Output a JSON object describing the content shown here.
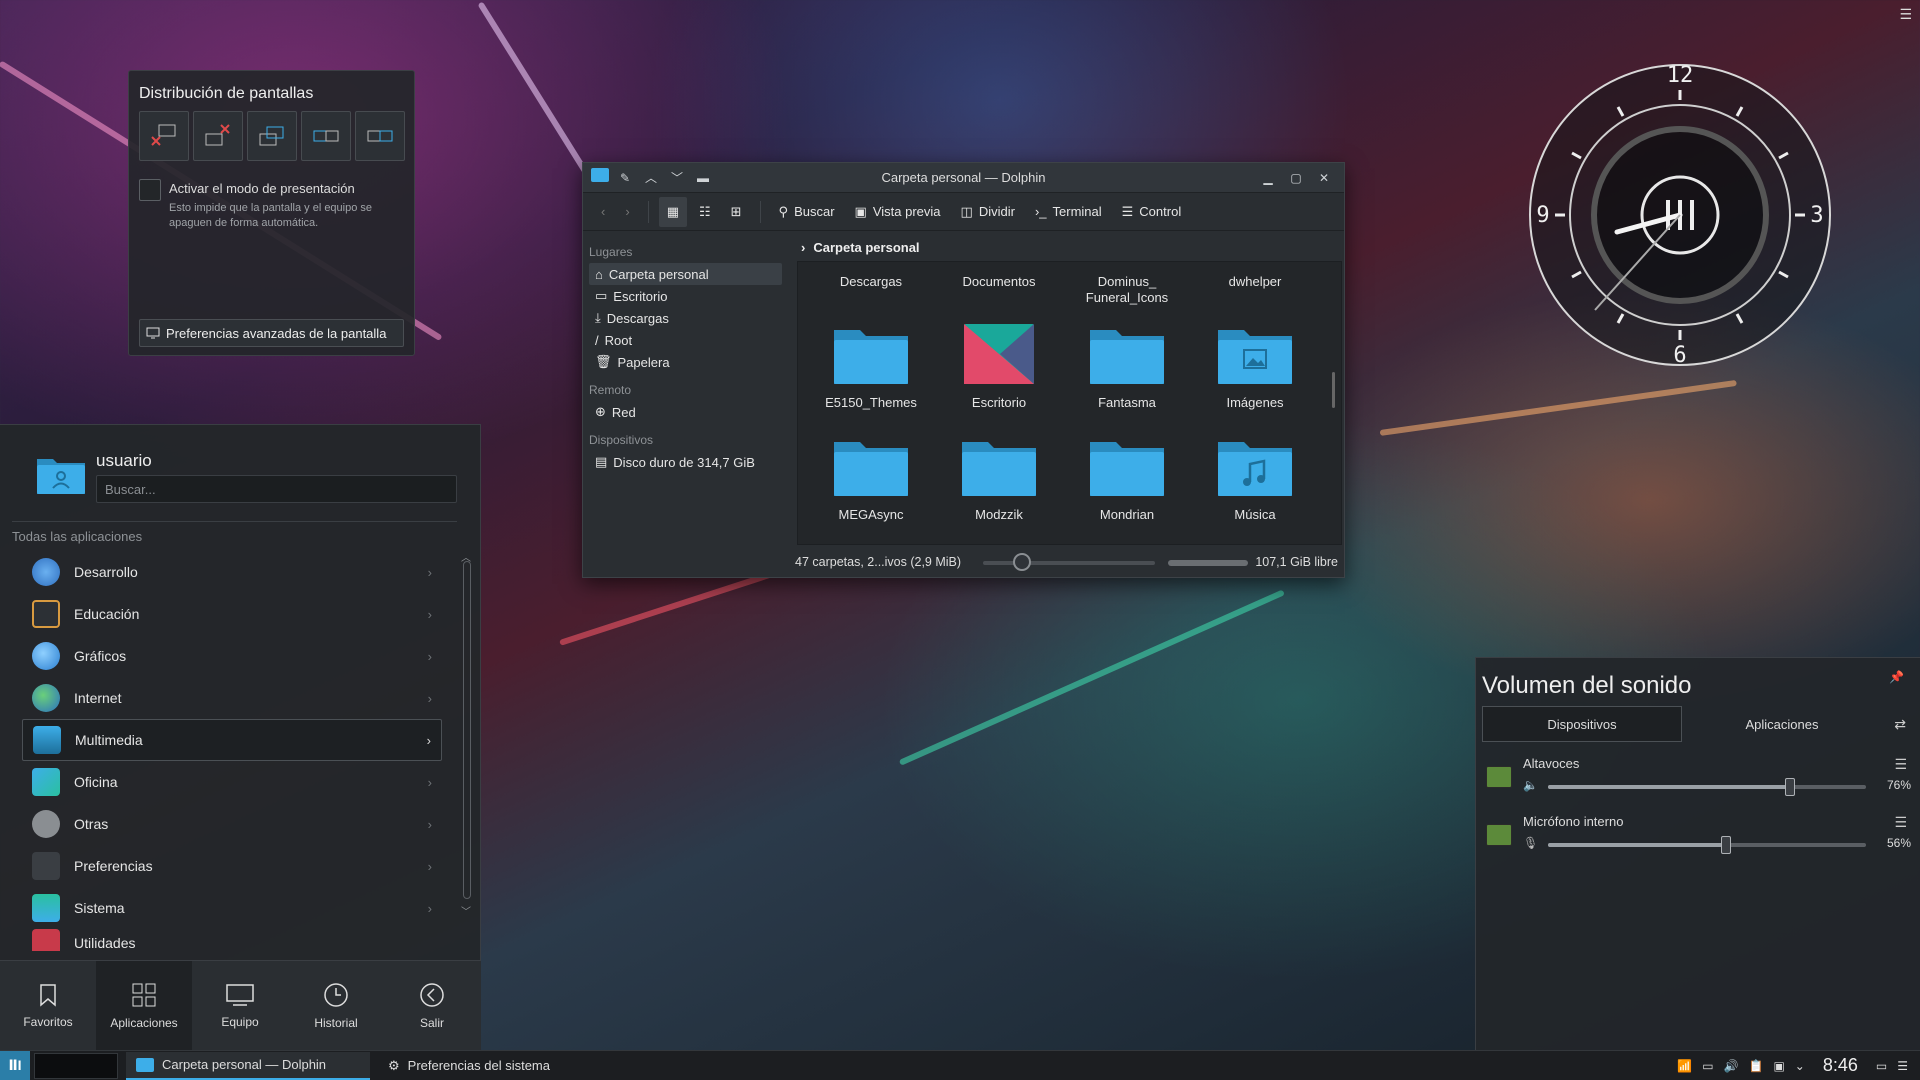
{
  "screen_layout": {
    "title": "Distribución de pantallas",
    "presentation_label": "Activar el modo de presentación",
    "presentation_desc": "Esto impide que la pantalla y el equipo se apaguen de forma automática.",
    "advanced_label": "Preferencias avanzadas de la pantalla"
  },
  "clock": {
    "n12": "12",
    "n3": "3",
    "n6": "6",
    "n9": "9"
  },
  "dolphin": {
    "title": "Carpeta personal — Dolphin",
    "toolbar": {
      "search": "Buscar",
      "preview": "Vista previa",
      "split": "Dividir",
      "terminal": "Terminal",
      "control": "Control"
    },
    "places": {
      "header_places": "Lugares",
      "items": [
        "Carpeta personal",
        "Escritorio",
        "Descargas",
        "Root",
        "Papelera"
      ],
      "header_remote": "Remoto",
      "remote": [
        "Red"
      ],
      "header_devices": "Dispositivos",
      "devices": [
        "Disco duro de 314,7 GiB"
      ]
    },
    "breadcrumb": "Carpeta personal",
    "row0": [
      "Descargas",
      "Documentos",
      "Dominus_\nFuneral_Icons",
      "dwhelper"
    ],
    "row1": [
      "E5150_Themes",
      "Escritorio",
      "Fantasma",
      "Imágenes"
    ],
    "row2": [
      "MEGAsync",
      "Modzzik",
      "Mondrian",
      "Música"
    ],
    "status": "47 carpetas, 2...ivos (2,9 MiB)",
    "free": "107,1 GiB libre",
    "colors": {
      "folder": "#3daee9",
      "folder_dark": "#2a8cc0"
    }
  },
  "menu": {
    "user": "usuario",
    "search_placeholder": "Buscar...",
    "all_apps": "Todas las aplicaciones",
    "apps": [
      "Desarrollo",
      "Educación",
      "Gráficos",
      "Internet",
      "Multimedia",
      "Oficina",
      "Otras",
      "Preferencias",
      "Sistema",
      "Utilidades"
    ],
    "tabs": [
      "Favoritos",
      "Aplicaciones",
      "Equipo",
      "Historial",
      "Salir"
    ]
  },
  "volume": {
    "title": "Volumen del sonido",
    "tab_devices": "Dispositivos",
    "tab_apps": "Aplicaciones",
    "devices": [
      {
        "name": "Altavoces",
        "level": 76,
        "pct": "76%"
      },
      {
        "name": "Micrófono interno",
        "level": 56,
        "pct": "56%"
      }
    ]
  },
  "taskbar": {
    "tasks": [
      "Carpeta personal — Dolphin",
      "Preferencias del sistema"
    ],
    "time": "8:46"
  }
}
